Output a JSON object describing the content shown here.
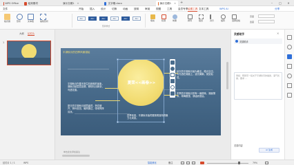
{
  "titlebar": {
    "tabs": [
      {
        "label": "WPS Office",
        "color": "#d64a2c"
      },
      {
        "label": "稻壳素材",
        "color": "#d64a2c"
      },
      {
        "label": "演示文稿1",
        "color": "#e06a2a"
      },
      {
        "label": "文字稿.docx",
        "color": "#2f6fd8"
      },
      {
        "label": "演示文稿1",
        "color": "#e06a2a"
      }
    ],
    "new_tab": "+"
  },
  "menubar": {
    "items": [
      "文件",
      "开始",
      "插入",
      "设计",
      "切换",
      "动画",
      "放映",
      "审阅",
      "视图",
      "工具",
      "会员专享",
      "绘图工具",
      "文本工具"
    ],
    "active": "绘图工具",
    "wps_ai": "WPS AI",
    "share": "分享"
  },
  "ribbon": {
    "tools": [
      {
        "label": "格式刷",
        "icon": "format-painter-icon"
      },
      {
        "label": "形状",
        "icon": "shapes-icon"
      },
      {
        "label": "文本框",
        "icon": "textbox-icon"
      },
      {
        "label": "编辑形状",
        "icon": "edit-shape-icon"
      }
    ],
    "styles": [
      "Abc",
      "Abc",
      "Abc",
      "Abc",
      "Abc",
      "Abc"
    ],
    "style_group_label": "形状样式",
    "right_tools": [
      {
        "label": "填充",
        "icon": "fill-icon"
      },
      {
        "label": "轮廓",
        "icon": "outline-icon"
      },
      {
        "label": "效果",
        "icon": "effects-icon"
      },
      {
        "label": "排列",
        "icon": "arrange-icon"
      },
      {
        "label": "组合",
        "icon": "group-icon"
      },
      {
        "label": "对齐",
        "icon": "align-icon"
      },
      {
        "label": "旋转",
        "icon": "rotate-icon"
      },
      {
        "label": "选择窗格",
        "icon": "select-pane-icon"
      }
    ],
    "size": {
      "height": "高度",
      "width": "宽度"
    }
  },
  "leftpanel": {
    "tab_outline": "大纲",
    "tab_slides": "幻灯片",
    "slide_number": "1"
  },
  "slide": {
    "header": "平湖秋月的四季风景描绘",
    "title": "夏荣<<画卷>>",
    "paragraph_left_top": "平湖秋月在春天是生机勃勃的景象，湖面泛起层层涟漪，柳枝吐出新芽，鸟语花香。",
    "paragraph_left_bottom": "夏日的平湖秋月绿意盎然，荷花盛开，荷叶田田，微风拂过，带来阵阵清凉。",
    "paragraph_right_top": "秋天的平湖秋月最为著名，皓月当空，月光洒在湖面上，波光粼粼，宛如仙境。",
    "paragraph_right_mid": "冬季的平湖秋月别有一番韵味，湖面薄冰，寒梅傲雪，静谧而悠远。",
    "paragraph_bottom_center": "四季轮回，平湖秋月始终展现着独特的魅力与风采。"
  },
  "rightpanel": {
    "title": "灵感助手",
    "item": "灵感助手",
    "input_placeholder": "例如：帮我写一段关于平湖秋月的描述，语气优美，要求 ...",
    "bottom_button": "AI 生成",
    "footer_label": "灵感内容"
  },
  "statusbar": {
    "slide_info": "幻灯片 1 / 1",
    "theme": "WPS",
    "notes": "单击此处添加备注",
    "smart_beauty": "智能美化",
    "view_label": "备注",
    "zoom": "79%"
  },
  "colors": {
    "accent": "#d64a2c",
    "slide_bg": "#4a6d8d",
    "moon": "#f2dc72"
  }
}
